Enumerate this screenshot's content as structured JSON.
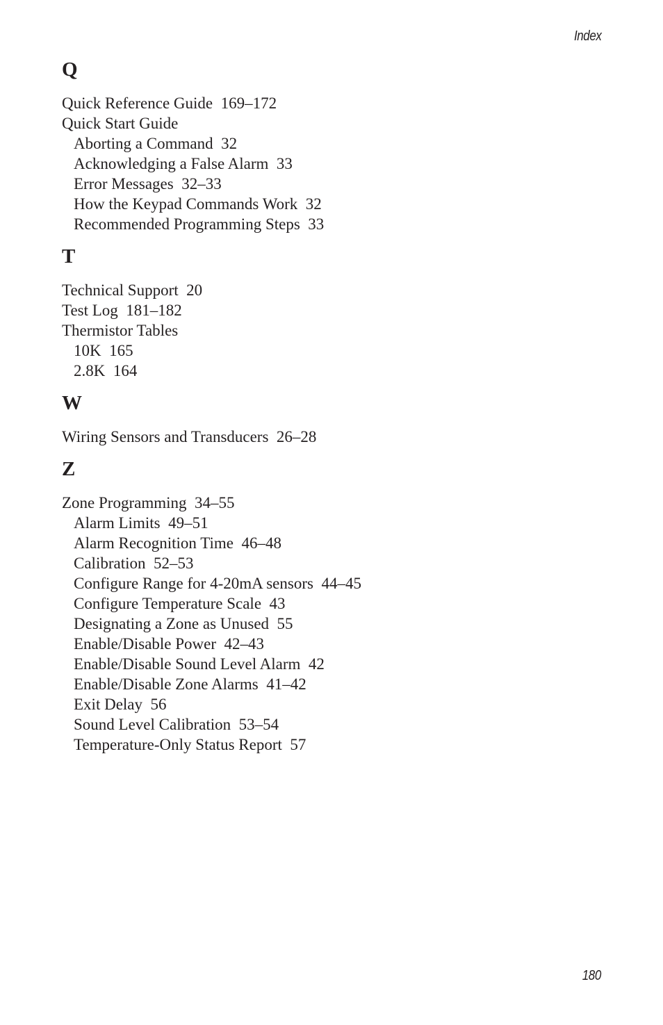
{
  "header": {
    "running_head": "Index"
  },
  "footer": {
    "page_number": "180"
  },
  "sections": [
    {
      "letter": "Q",
      "entries": [
        {
          "term": "Quick Reference Guide",
          "pages": "169–172",
          "level": 0
        },
        {
          "term": "Quick Start Guide",
          "pages": "",
          "level": 0
        },
        {
          "term": "Aborting a Command",
          "pages": "32",
          "level": 1
        },
        {
          "term": "Acknowledging a False Alarm",
          "pages": "33",
          "level": 1
        },
        {
          "term": "Error Messages",
          "pages": "32–33",
          "level": 1
        },
        {
          "term": "How the Keypad Commands Work",
          "pages": "32",
          "level": 1
        },
        {
          "term": "Recommended Programming Steps",
          "pages": "33",
          "level": 1
        }
      ]
    },
    {
      "letter": "T",
      "entries": [
        {
          "term": "Technical Support",
          "pages": "20",
          "level": 0
        },
        {
          "term": "Test Log",
          "pages": "181–182",
          "level": 0
        },
        {
          "term": "Thermistor Tables",
          "pages": "",
          "level": 0
        },
        {
          "term": "10K",
          "pages": "165",
          "level": 1
        },
        {
          "term": "2.8K",
          "pages": "164",
          "level": 1
        }
      ]
    },
    {
      "letter": "W",
      "entries": [
        {
          "term": "Wiring Sensors and Transducers",
          "pages": "26–28",
          "level": 0
        }
      ]
    },
    {
      "letter": "Z",
      "entries": [
        {
          "term": "Zone Programming",
          "pages": "34–55",
          "level": 0
        },
        {
          "term": "Alarm Limits",
          "pages": "49–51",
          "level": 1
        },
        {
          "term": "Alarm Recognition Time",
          "pages": "46–48",
          "level": 1
        },
        {
          "term": "Calibration",
          "pages": "52–53",
          "level": 1
        },
        {
          "term": "Configure Range for 4-20mA sensors",
          "pages": "44–45",
          "level": 1
        },
        {
          "term": "Configure Temperature Scale",
          "pages": "43",
          "level": 1
        },
        {
          "term": "Designating a Zone as Unused",
          "pages": "55",
          "level": 1
        },
        {
          "term": "Enable/Disable Power",
          "pages": "42–43",
          "level": 1
        },
        {
          "term": "Enable/Disable Sound Level Alarm",
          "pages": "42",
          "level": 1
        },
        {
          "term": "Enable/Disable Zone Alarms",
          "pages": "41–42",
          "level": 1
        },
        {
          "term": "Exit Delay",
          "pages": "56",
          "level": 1
        },
        {
          "term": "Sound Level Calibration",
          "pages": "53–54",
          "level": 1
        },
        {
          "term": "Temperature-Only Status Report",
          "pages": "57",
          "level": 1
        }
      ]
    }
  ]
}
